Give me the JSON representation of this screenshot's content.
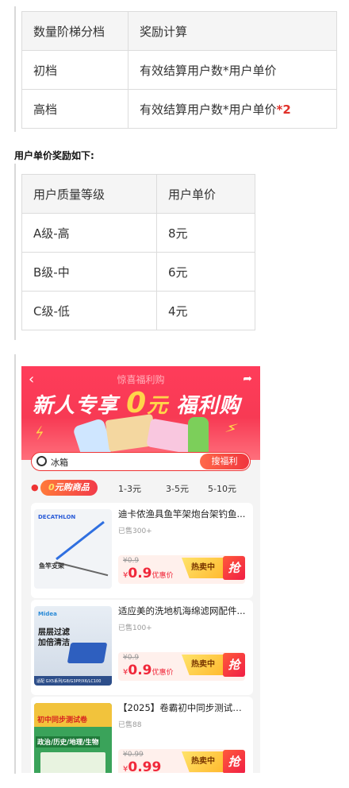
{
  "table1": {
    "headers": [
      "数量阶梯分档",
      "奖励计算"
    ],
    "rows": [
      {
        "tier": "初档",
        "calc": "有效结算用户数*用户单价",
        "extra": ""
      },
      {
        "tier": "高档",
        "calc": "有效结算用户数*用户单价",
        "extra": "*2"
      }
    ]
  },
  "subheading": "用户单价奖励如下:",
  "table2": {
    "headers": [
      "用户质量等级",
      "用户单价"
    ],
    "rows": [
      {
        "level": "A级-高",
        "price": "8元"
      },
      {
        "level": "B级-中",
        "price": "6元"
      },
      {
        "level": "C级-低",
        "price": "4元"
      }
    ]
  },
  "phone": {
    "page_title": "惊喜福利购",
    "slogan_prefix": "新人专享",
    "slogan_zero": "0",
    "slogan_yuan": "元",
    "slogan_suffix": "福利购",
    "search": {
      "text": "冰箱",
      "button": "搜福利"
    },
    "filter_chip": {
      "zero": "0",
      "rest": "元购商品"
    },
    "filter_tabs": [
      "1-3元",
      "3-5元",
      "5-10元"
    ],
    "products": [
      {
        "name": "迪卡侬渔具鱼竿架炮台架钓鱼...",
        "sold": "已售300+",
        "old_price": "¥0.9",
        "currency": "¥",
        "price": "0.9",
        "price_note": "优惠价",
        "hot": "热卖中",
        "grab": "抢",
        "thumb_brand": "DECATHLON",
        "thumb_text": "鱼竿支架"
      },
      {
        "name": "适应美的洗地机海绵滤网配件...",
        "sold": "已售100+",
        "old_price": "¥0.9",
        "currency": "¥",
        "price": "0.9",
        "price_note": "优惠价",
        "hot": "热卖中",
        "grab": "抢",
        "thumb_brand": "Midea",
        "thumb_text_1": "层层过滤",
        "thumb_text_2": "加倍清洁",
        "thumb_caption": "适配 GX5系列/G8/G3PP/X6/LC100"
      },
      {
        "name": "【2025】卷霸初中同步测试卷...",
        "sold": "已售88",
        "old_price": "¥0.99",
        "currency": "¥",
        "price": "0.99",
        "price_note": "",
        "hot": "热卖中",
        "grab": "抢",
        "thumb_text_1": "初中同步测试卷",
        "thumb_text_2": "政治/历史/地理/生物"
      }
    ]
  },
  "colors": {
    "accent": "#f73a54",
    "price_red": "#f0283a",
    "hot_yellow": "#ffd54a",
    "highlight_red": "#e0312a"
  }
}
